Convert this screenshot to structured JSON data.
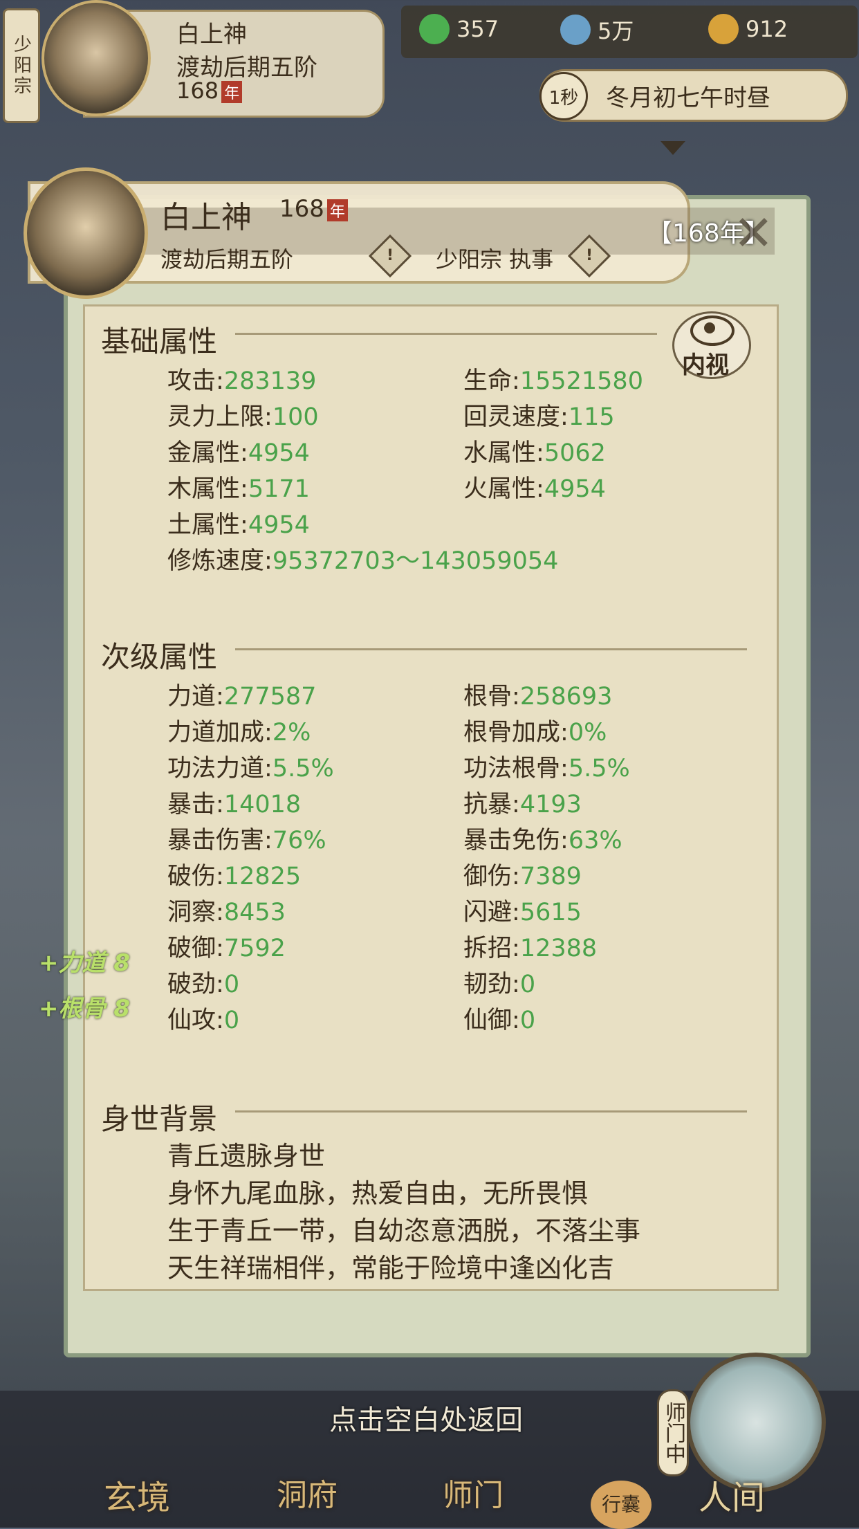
{
  "top": {
    "sect_tab": "少阳宗",
    "name": "白上神",
    "rank": "渡劫后期五阶",
    "age": "168",
    "age_unit": "年",
    "resources": [
      {
        "icon": "leaf-icon",
        "value": "357",
        "color": "#4caf50"
      },
      {
        "icon": "coin-icon",
        "value": "5万",
        "color": "#6aa0c8"
      },
      {
        "icon": "ingot-icon",
        "value": "912",
        "color": "#d8a23a"
      }
    ],
    "time_speed": "1秒",
    "time_text": "冬月初七午时昼"
  },
  "header": {
    "name": "白上神",
    "age": "168",
    "age_unit": "年",
    "rank": "渡劫后期五阶",
    "sect": "少阳宗 执事",
    "years_badge": "【168年】",
    "info_glyph": "!"
  },
  "inner_view_label": "内视",
  "basic": {
    "title": "基础属性",
    "stats": [
      {
        "label": "攻击",
        "value": "283139"
      },
      {
        "label": "生命",
        "value": "15521580"
      },
      {
        "label": "灵力上限",
        "value": "100"
      },
      {
        "label": "回灵速度",
        "value": "115"
      },
      {
        "label": "金属性",
        "value": "4954"
      },
      {
        "label": "水属性",
        "value": "5062"
      },
      {
        "label": "木属性",
        "value": "5171"
      },
      {
        "label": "火属性",
        "value": "4954"
      },
      {
        "label": "土属性",
        "value": "4954"
      },
      {
        "label": "修炼速度",
        "value": "95372703～143059054"
      }
    ]
  },
  "secondary": {
    "title": "次级属性",
    "stats": [
      {
        "label": "力道",
        "value": "277587"
      },
      {
        "label": "根骨",
        "value": "258693"
      },
      {
        "label": "力道加成",
        "value": "2%"
      },
      {
        "label": "根骨加成",
        "value": "0%"
      },
      {
        "label": "功法力道",
        "value": "5.5%"
      },
      {
        "label": "功法根骨",
        "value": "5.5%"
      },
      {
        "label": "暴击",
        "value": "14018"
      },
      {
        "label": "抗暴",
        "value": "4193"
      },
      {
        "label": "暴击伤害",
        "value": "76%"
      },
      {
        "label": "暴击免伤",
        "value": "63%"
      },
      {
        "label": "破伤",
        "value": "12825"
      },
      {
        "label": "御伤",
        "value": "7389"
      },
      {
        "label": "洞察",
        "value": "8453"
      },
      {
        "label": "闪避",
        "value": "5615"
      },
      {
        "label": "破御",
        "value": "7592"
      },
      {
        "label": "拆招",
        "value": "12388"
      },
      {
        "label": "破劲",
        "value": "0"
      },
      {
        "label": "韧劲",
        "value": "0"
      },
      {
        "label": "仙攻",
        "value": "0"
      },
      {
        "label": "仙御",
        "value": "0"
      }
    ]
  },
  "gains": [
    "+力道 8",
    "+根骨 8"
  ],
  "background": {
    "title": "身世背景",
    "lines": [
      "青丘遗脉身世",
      "身怀九尾血脉，热爱自由，无所畏惧",
      "生于青丘一带，自幼恣意洒脱，不落尘事",
      "天生祥瑞相伴，常能于险境中逢凶化吉"
    ]
  },
  "hint": "点击空白处返回",
  "nav": {
    "xuanjing": "玄境",
    "dongfu": "洞府",
    "shimen": "师门",
    "xingnang": "行囊",
    "shimen_vertical": "师门中",
    "renjian": "人间"
  }
}
